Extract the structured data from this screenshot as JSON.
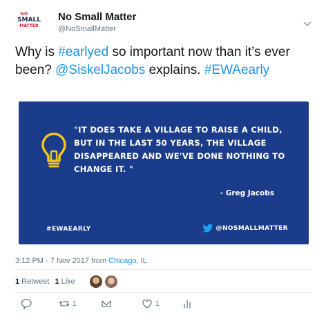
{
  "account": {
    "logo_line1": "NO",
    "logo_line2": "SMALL",
    "logo_line3": "MATTER",
    "display_name": "No Small Matter",
    "handle": "@NoSmallMatter"
  },
  "tweet": {
    "text_before": "Why is ",
    "hashtag1": "#earlyed",
    "text_middle": " so important now than it’s ever been? ",
    "mention": "@SiskelJacobs",
    "text_after": " explains. ",
    "hashtag2": "#EWAearly"
  },
  "card": {
    "quote": "\"IT DOES TAKE A VILLAGE TO RAISE A CHILD, BUT IN THE LAST 50 YEARS, THE VILLAGE DISAPPEARED AND WE'VE DONE NOTHING TO CHANGE IT.  \"",
    "attribution": "- Greg Jacobs",
    "hashtag": "#EWAEARLY",
    "twitter_handle": "@NOSMALLMATTER",
    "background_color": "#1b3c8a",
    "icon": "lightbulb-icon"
  },
  "meta": {
    "timestamp": "3:12 PM - 7 Nov 2017 from ",
    "location": "Chicago, IL"
  },
  "stats": {
    "retweets_count": "1",
    "retweets_label": "Retweet",
    "likes_count": "1",
    "likes_label": "Like"
  },
  "actions": {
    "reply_icon": "reply-icon",
    "retweet_count": "1",
    "like_count": "1",
    "dm_icon": "direct-message-icon",
    "analytics_icon": "analytics-icon"
  },
  "colors": {
    "link": "#1b95e0",
    "muted": "#657786",
    "lightbulb": "#f5c51e"
  }
}
